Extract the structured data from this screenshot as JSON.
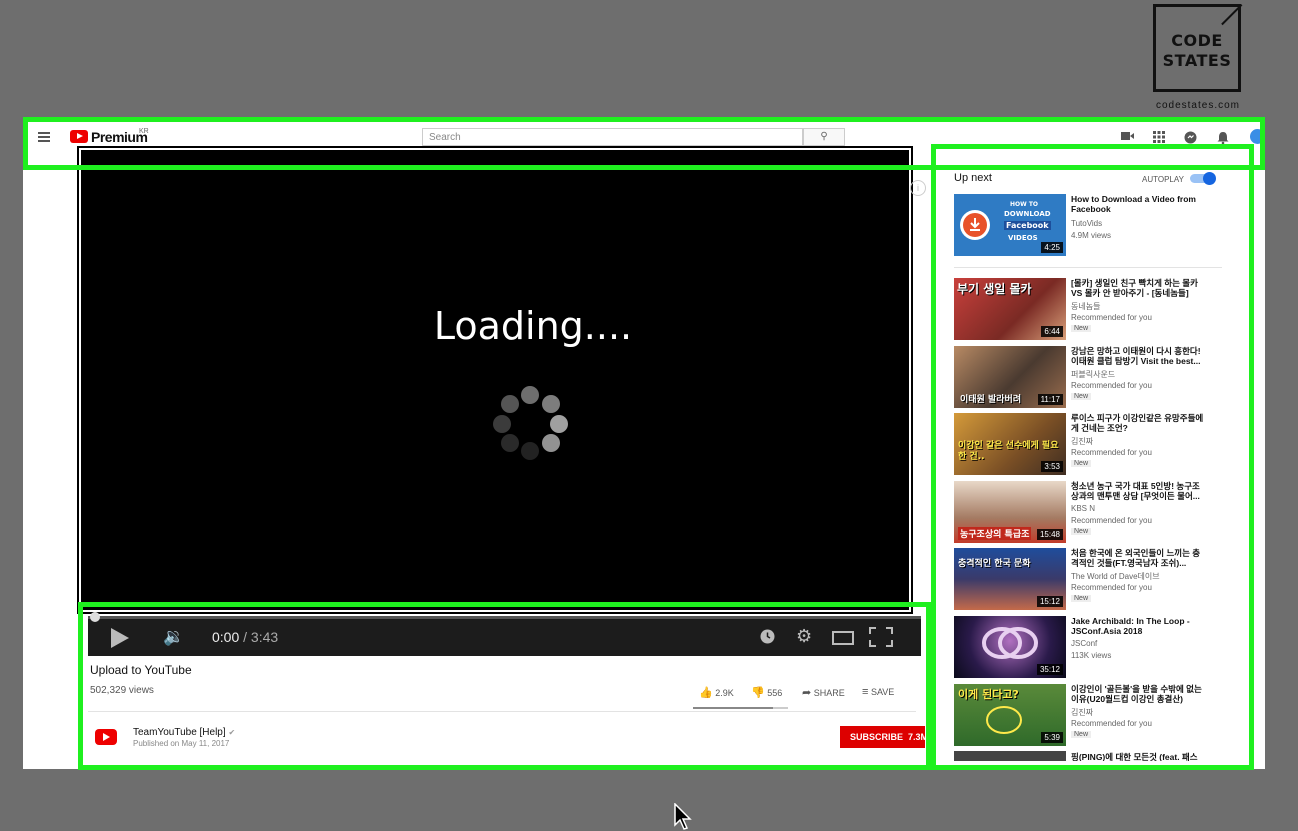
{
  "logo": {
    "line1": "CODE",
    "line2": "STATES",
    "url": "codestates.com"
  },
  "header": {
    "brand": "Premium",
    "brand_region": "KR",
    "search_placeholder": "Search",
    "icons": [
      "menu-icon",
      "youtube-logo-icon",
      "search-icon",
      "create-video-icon",
      "apps-grid-icon",
      "messages-icon",
      "notifications-bell-icon",
      "avatar-icon"
    ]
  },
  "player": {
    "overlay_text": "Loading....",
    "current_time": "0:00",
    "separator": " / ",
    "duration": "3:43",
    "progress_fraction": 0.0,
    "icons": [
      "play-icon",
      "volume-icon",
      "watch-later-icon",
      "settings-gear-icon",
      "theater-mode-icon",
      "fullscreen-icon"
    ]
  },
  "video": {
    "title": "Upload to YouTube",
    "views": "502,329 views",
    "likes": "2.9K",
    "dislikes": "556",
    "share_label": "SHARE",
    "save_label": "SAVE",
    "channel": "TeamYouTube [Help]",
    "published": "Published on May 11, 2017",
    "subscribe_label": "SUBSCRIBE",
    "subscriber_count": "7.3M"
  },
  "sidebar": {
    "up_next_label": "Up next",
    "autoplay_label": "AUTOPLAY",
    "autoplay_on": true,
    "videos": [
      {
        "title": "How to Download a Video from Facebook",
        "channel": "TutoVids",
        "meta": "4.9M views",
        "duration": "4:25",
        "badge": ""
      },
      {
        "title": "[몰카] 생일인 친구 빡치게 하는 몰카 VS 몰카 안 받아주기 - [동네놈들]",
        "channel": "동네놈들",
        "meta": "Recommended for you",
        "duration": "6:44",
        "badge": "New"
      },
      {
        "title": "강남은 망하고 이태원이 다시 흥한다! 이태원 클럽 탐방기 Visit the best...",
        "channel": "퍼블릭사운드",
        "meta": "Recommended for you",
        "duration": "11:17",
        "badge": "New"
      },
      {
        "title": "루이스 피구가 이강인같은 유망주들에게 건네는 조언?",
        "channel": "김진짜",
        "meta": "Recommended for you",
        "duration": "3:53",
        "badge": "New"
      },
      {
        "title": "청소년 농구 국가 대표 5인방! 농구조상과의 맨투맨 상담 [무엇이든 물어...",
        "channel": "KBS N",
        "meta": "Recommended for you",
        "duration": "15:48",
        "badge": "New"
      },
      {
        "title": "처음 한국에 온 외국인들이 느끼는 충격적인 것들(FT.영국남자 조쉬)...",
        "channel": "The World of Dave데이브",
        "meta": "Recommended for you",
        "duration": "15:12",
        "badge": "New"
      },
      {
        "title": "Jake Archibald: In The Loop - JSConf.Asia 2018",
        "channel": "JSConf",
        "meta": "113K views",
        "duration": "35:12",
        "badge": ""
      },
      {
        "title": "이강인이 '골든볼'을 받을 수밖에 없는 이유(U20월드컵 이강인 총결산)",
        "channel": "김진짜",
        "meta": "Recommended for you",
        "duration": "5:39",
        "badge": "New"
      },
      {
        "title": "핑(PING)에 대한 모든것 (feat. 패스",
        "channel": "",
        "meta": "",
        "duration": "",
        "badge": ""
      }
    ]
  },
  "thumb_texts": {
    "t1_line1": "HOW TO",
    "t1_line2": "DOWNLOAD",
    "t1_line3": "Facebook",
    "t1_line4": "VIDEOS",
    "t2": "부기 생일 몰카",
    "t3": "이태원 발라버려",
    "t4": "이강인 같은 선수에게 필요한 건..",
    "t5": "농구조상의 특급조",
    "t6": "충격적인 한국 문화",
    "t8": "이게 된다고?"
  },
  "colors": {
    "highlight": "#1ff01f",
    "youtube_red": "#e00000",
    "autoplay_blue": "#1565e0",
    "background": "#6e6e6e"
  }
}
